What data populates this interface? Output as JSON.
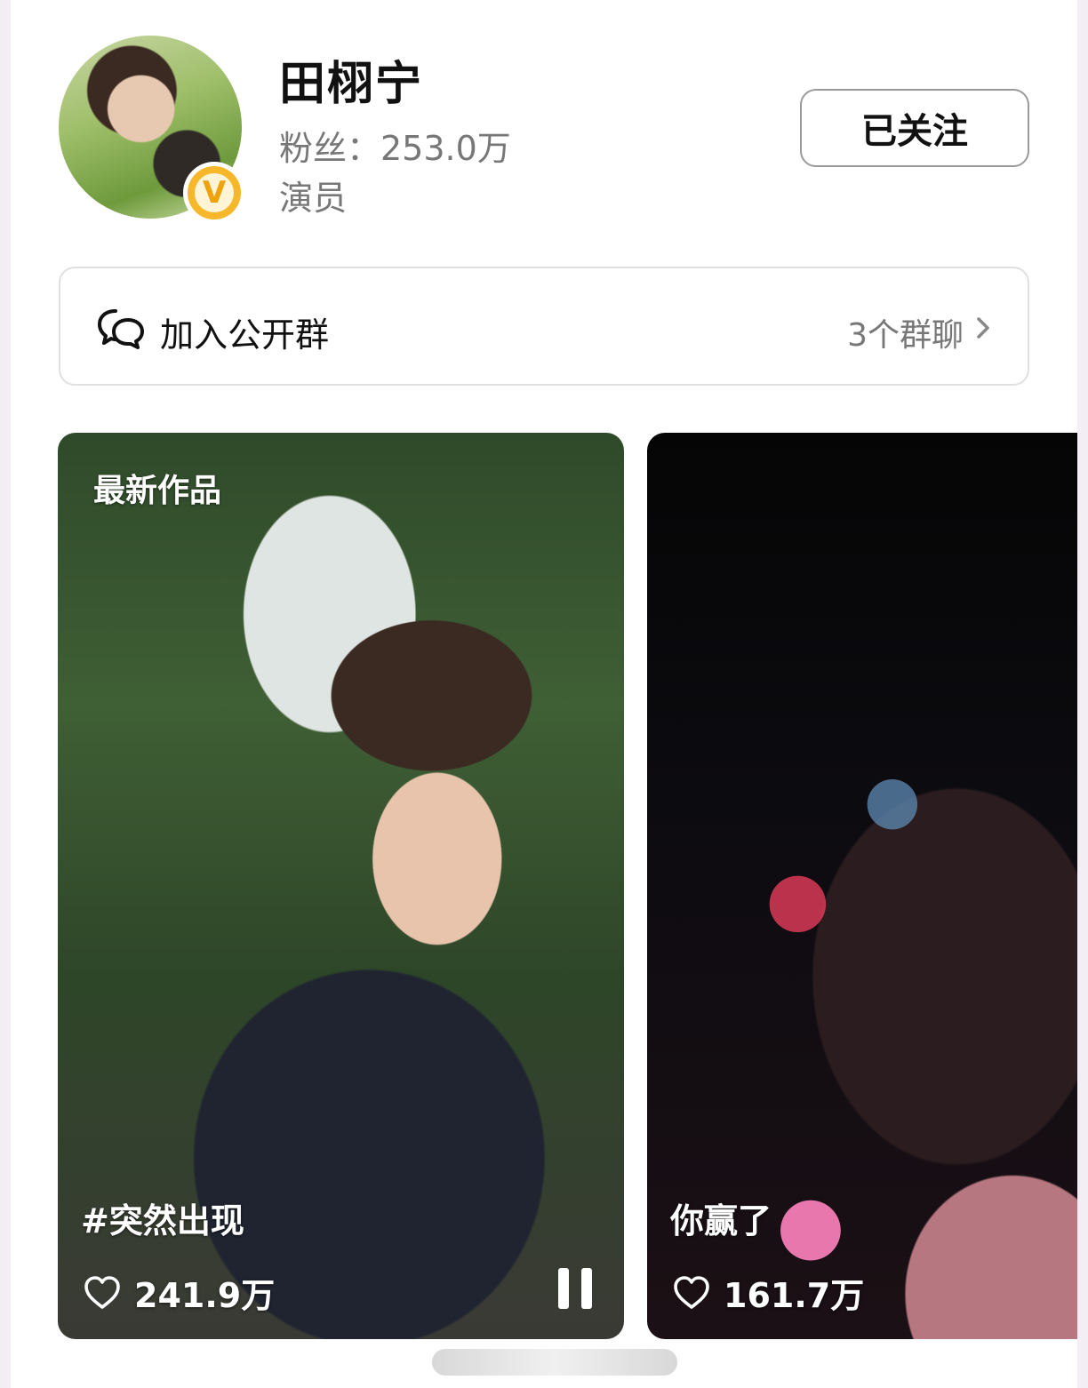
{
  "profile": {
    "name": "田栩宁",
    "fans": "粉丝：253.0万",
    "role": "演员",
    "verified_icon": "verified-v-badge",
    "follow_label": "已关注"
  },
  "group": {
    "label": "加入公开群",
    "count": "3个群聊",
    "icon": "chat-bubbles-icon"
  },
  "cards": [
    {
      "tag": "最新作品",
      "title": "#突然出现",
      "likes": "241.9万",
      "playing": true
    },
    {
      "title": "你赢了",
      "likes": "161.7万"
    }
  ],
  "colors": {
    "badge": "#f6b72b",
    "muted_text": "#777777",
    "border": "#e0e0e0"
  }
}
